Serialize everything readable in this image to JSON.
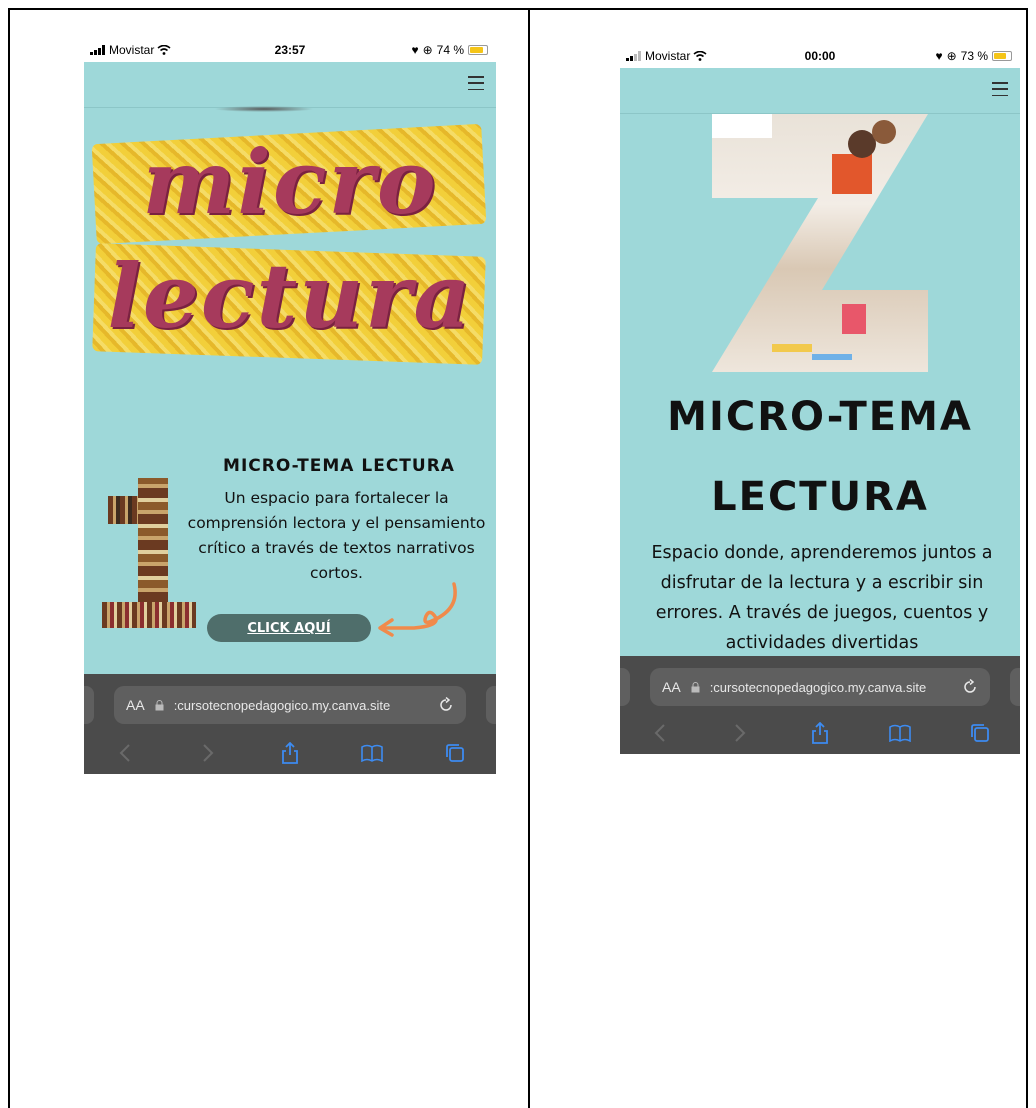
{
  "left_phone": {
    "status": {
      "carrier": "Movistar",
      "time": "23:57",
      "battery": "74 %",
      "battery_level": 0.74
    },
    "header": {
      "menu_icon": "hamburger-menu-icon"
    },
    "collage_title": {
      "line1": "micro",
      "line2": "lectura"
    },
    "section": {
      "number": "1",
      "title": "MICRO-TEMA LECTURA",
      "text": "Un espacio para fortalecer la comprensión lectora y el pensamiento crítico a través de textos narrativos cortos.",
      "button": "CLICK AQUÍ"
    },
    "browser": {
      "text_size": "AA",
      "url": ":cursotecnopedagogico.my.canva.site",
      "icons": [
        "back-icon",
        "forward-icon",
        "share-icon",
        "bookmarks-icon",
        "tabs-icon"
      ]
    }
  },
  "right_phone": {
    "status": {
      "carrier": "Movistar",
      "time": "00:00",
      "battery": "73 %",
      "battery_level": 0.73
    },
    "header": {
      "menu_icon": "hamburger-menu-icon"
    },
    "title_line1": "MICRO-TEMA",
    "title_line2": "LECTURA",
    "text": "Espacio donde, aprenderemos juntos a disfrutar de la lectura y a escribir sin errores. A través de juegos, cuentos y actividades divertidas",
    "browser": {
      "text_size": "AA",
      "url": ":cursotecnopedagogico.my.canva.site",
      "icons": [
        "back-icon",
        "forward-icon",
        "share-icon",
        "bookmarks-icon",
        "tabs-icon"
      ]
    }
  },
  "colors": {
    "page_background": "#9ed8d9",
    "title_magenta": "#a63a5c",
    "button": "#4f6e6b",
    "arrow": "#f08a4b",
    "browser_bar": "#4b4b4b"
  }
}
